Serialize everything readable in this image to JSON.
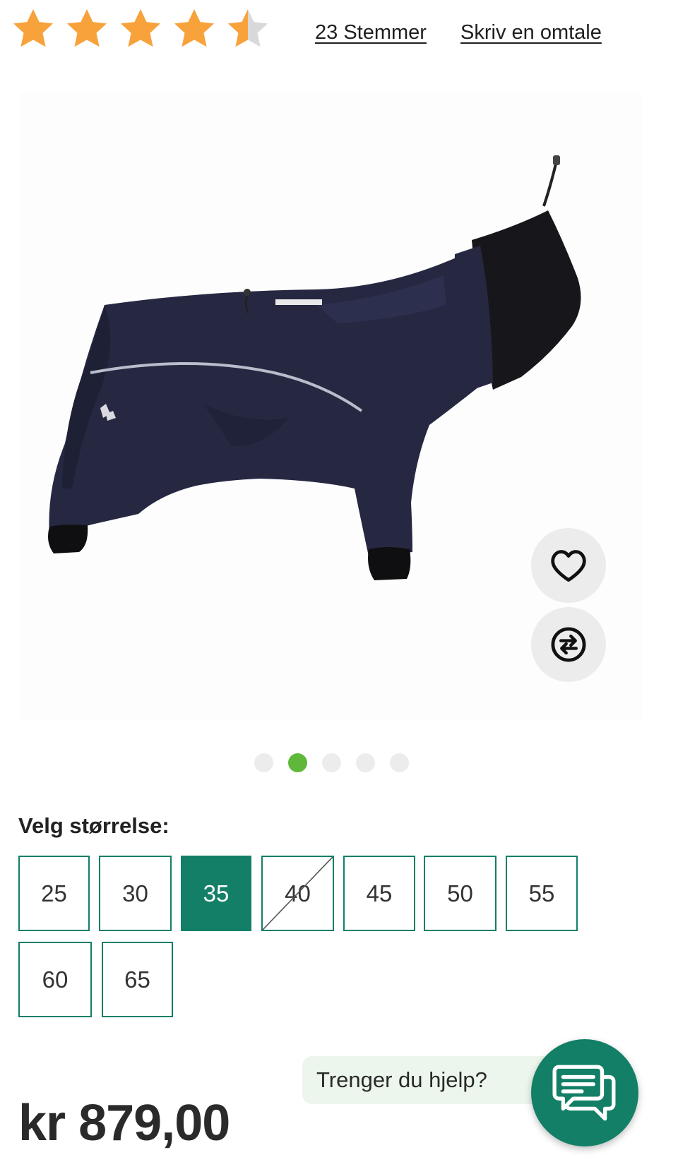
{
  "rating": {
    "value": 4.5,
    "max": 5,
    "star_color": "#f7a23b",
    "empty_star_color": "#d9d9d9",
    "votes_label": "23 Stemmer",
    "write_review_label": "Skriv en omtale"
  },
  "gallery": {
    "image_count": 5,
    "active_index": 1,
    "favorite_icon": "heart-icon",
    "compare_icon": "compare-arrows-icon"
  },
  "sizes": {
    "title": "Velg størrelse:",
    "accent_color": "#137f67",
    "options": [
      {
        "label": "25",
        "state": "available"
      },
      {
        "label": "30",
        "state": "available"
      },
      {
        "label": "35",
        "state": "selected"
      },
      {
        "label": "40",
        "state": "unavailable"
      },
      {
        "label": "45",
        "state": "available"
      },
      {
        "label": "50",
        "state": "available"
      },
      {
        "label": "55",
        "state": "available"
      },
      {
        "label": "60",
        "state": "available"
      },
      {
        "label": "65",
        "state": "available"
      }
    ]
  },
  "price": "kr 879,00",
  "help": {
    "label": "Trenger du hjelp?",
    "icon": "chat-icon"
  }
}
